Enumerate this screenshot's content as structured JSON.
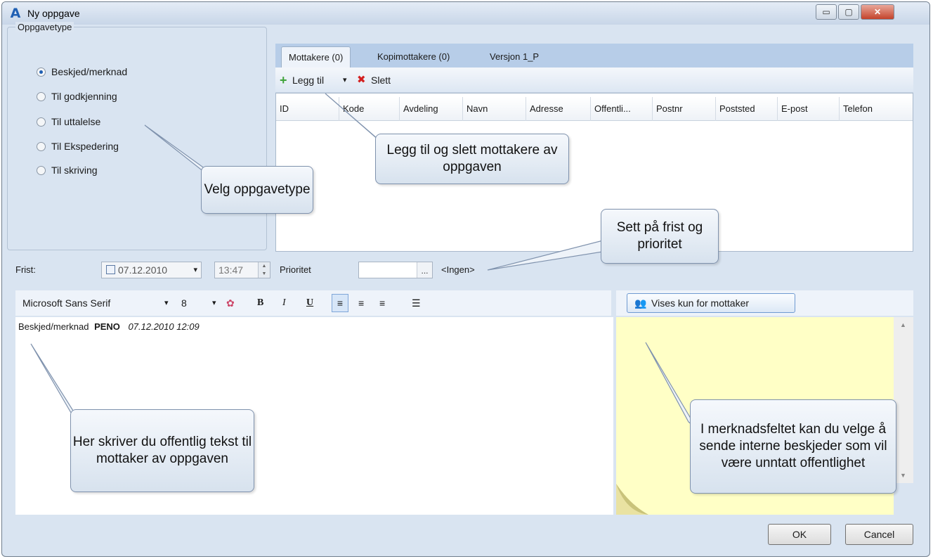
{
  "window": {
    "title": "Ny oppgave",
    "app_icon": "A",
    "minimize": "▭",
    "maximize": "▢",
    "close": "✕"
  },
  "task_type": {
    "legend": "Oppgavetype",
    "options": [
      "Beskjed/merknad",
      "Til godkjenning",
      "Til uttalelse",
      "Til Ekspedering",
      "Til skriving"
    ],
    "selected": "Beskjed/merknad"
  },
  "tabs": [
    "Mottakere (0)",
    "Kopimottakere (0)",
    "Versjon 1_P"
  ],
  "toolbar": {
    "add_label": "Legg til",
    "delete_label": "Slett",
    "add_icon": "+",
    "delete_icon": "✖",
    "dropdown_icon": "▾"
  },
  "grid": {
    "columns": [
      "ID",
      "Kode",
      "Avdeling",
      "Navn",
      "Adresse",
      "Offentli...",
      "Postnr",
      "Poststed",
      "E-post",
      "Telefon"
    ]
  },
  "deadline": {
    "label": "Frist:",
    "date": "07.12.2010",
    "time": "13:47",
    "dropdown_icon": "▾"
  },
  "priority": {
    "label": "Prioritet",
    "value": "<Ingen>",
    "button": "..."
  },
  "editor": {
    "font": "Microsoft Sans Serif",
    "size": "8",
    "bold": "B",
    "italic": "I",
    "underline": "U",
    "text": {
      "type": "Beskjed/merknad",
      "user": "PENO",
      "timestamp": "07.12.2010 12:09"
    }
  },
  "note": {
    "button_label": "Vises kun for mottaker"
  },
  "buttons": {
    "ok": "OK",
    "cancel": "Cancel"
  },
  "callouts": {
    "task_type": "Velg oppgavetype",
    "recipients": "Legg til og slett mottakere av oppgaven",
    "deadline": "Sett på frist og prioritet",
    "public_text": "Her skriver du offentlig tekst til mottaker av oppgaven",
    "internal_note": "I merknadsfeltet kan du velge å sende interne beskjeder som vil være unntatt offentlighet"
  },
  "colors": {
    "accent": "#1f5fb3",
    "note_background": "#ffffc6",
    "delete": "#d32020",
    "add": "#3fa33a"
  }
}
